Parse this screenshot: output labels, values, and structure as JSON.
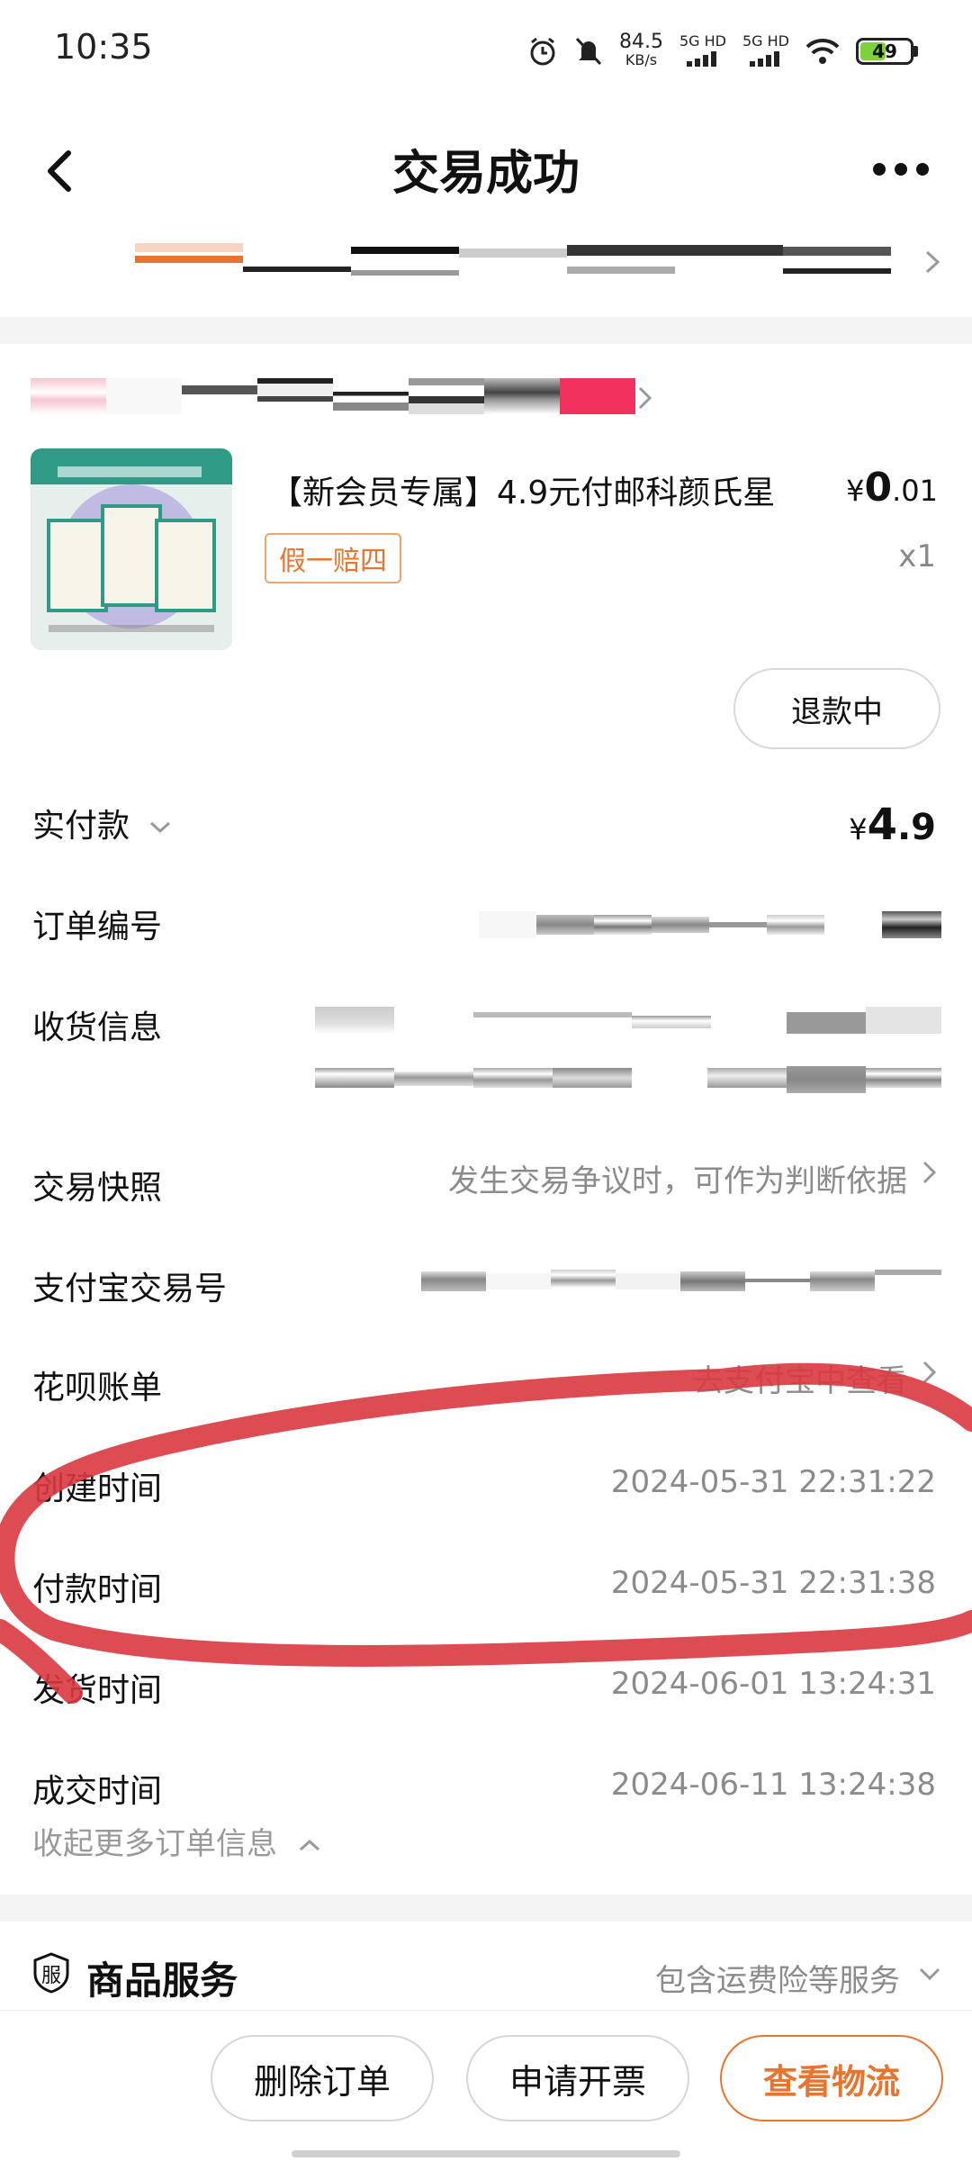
{
  "status_bar": {
    "time": "10:35",
    "net_speed": "84.5",
    "net_unit": "KB/s",
    "signal1": "5G HD",
    "signal2": "5G HD",
    "battery": "49"
  },
  "header": {
    "title": "交易成功",
    "back_icon": "chevron-left-icon",
    "more_icon": "more-dots-icon"
  },
  "product": {
    "title": "【新会员专属】4.9元付邮科颜氏星",
    "price_symbol": "¥",
    "price_int": "0",
    "price_dec": ".01",
    "tag": "假一赔四",
    "quantity": "x1",
    "refund_label": "退款中"
  },
  "order": {
    "paid_label": "实付款",
    "paid_symbol": "¥",
    "paid_int": "4",
    "paid_dec": ".9",
    "rows": [
      {
        "label": "订单编号",
        "value": ""
      },
      {
        "label": "收货信息",
        "value": ""
      },
      {
        "label": "交易快照",
        "value": "发生交易争议时，可作为判断依据"
      },
      {
        "label": "支付宝交易号",
        "value": ""
      },
      {
        "label": "花呗账单",
        "value": "去支付宝中查看"
      },
      {
        "label": "创建时间",
        "value": "2024-05-31 22:31:22"
      },
      {
        "label": "付款时间",
        "value": "2024-05-31 22:31:38"
      },
      {
        "label": "发货时间",
        "value": "2024-06-01 13:24:31"
      },
      {
        "label": "成交时间",
        "value": "2024-06-11 13:24:38"
      }
    ],
    "collapse_label": "收起更多订单信息"
  },
  "service": {
    "icon_text": "服",
    "title": "商品服务",
    "value": "包含运费险等服务"
  },
  "actions": {
    "delete": "删除订单",
    "invoice": "申请开票",
    "logistics": "查看物流"
  },
  "colors": {
    "accent": "#e8752e",
    "annotation": "#d9383f",
    "muted": "#8b8b8b"
  }
}
